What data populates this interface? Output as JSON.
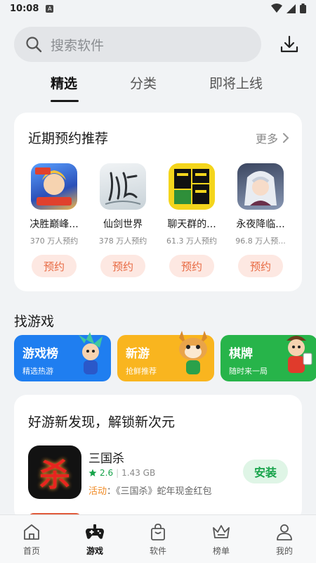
{
  "status_bar": {
    "time": "10:08",
    "notif_glyph": "A"
  },
  "search": {
    "placeholder": "搜索软件"
  },
  "tabs": [
    {
      "label": "精选",
      "active": true
    },
    {
      "label": "分类",
      "active": false
    },
    {
      "label": "即将上线",
      "active": false
    }
  ],
  "upcoming": {
    "title": "近期预约推荐",
    "more_label": "更多",
    "apps": [
      {
        "name": "决胜巅峰...",
        "count": "370 万人预约",
        "button": "预约",
        "icon": "mobile-legends-icon",
        "color": "#3a6fd8"
      },
      {
        "name": "仙剑世界",
        "count": "378 万人预约",
        "button": "预约",
        "icon": "xianjian-icon",
        "color": "#d9dfe3"
      },
      {
        "name": "聊天群的...",
        "count": "61.3 万人预约",
        "button": "预约",
        "icon": "chat-group-icon",
        "color": "#f2d21b"
      },
      {
        "name": "永夜降临...",
        "count": "96.8 万人预...",
        "button": "预约",
        "icon": "eternal-night-icon",
        "color": "#5a6a8a"
      }
    ]
  },
  "find_games": {
    "title": "找游戏",
    "categories": [
      {
        "title": "游戏榜",
        "subtitle": "精选热游",
        "color": "#1f7ef0"
      },
      {
        "title": "新游",
        "subtitle": "抢鲜推荐",
        "color": "#f9b51f"
      },
      {
        "title": "棋牌",
        "subtitle": "随时来一局",
        "color": "#27b44a"
      }
    ]
  },
  "discover": {
    "title": "好游新发现，解锁新次元",
    "app": {
      "name": "三国杀",
      "rating": "2.6",
      "size": "1.43 GB",
      "activity_label": "活动",
      "activity_text": "：《三国杀》蛇年现金红包",
      "install_label": "安装",
      "icon_glyph": "杀"
    }
  },
  "bottom_nav": [
    {
      "label": "首页",
      "icon": "home-icon",
      "active": false
    },
    {
      "label": "游戏",
      "icon": "gamepad-icon",
      "active": true
    },
    {
      "label": "软件",
      "icon": "shopping-bag-icon",
      "active": false
    },
    {
      "label": "榜单",
      "icon": "crown-icon",
      "active": false
    },
    {
      "label": "我的",
      "icon": "person-icon",
      "active": false
    }
  ]
}
